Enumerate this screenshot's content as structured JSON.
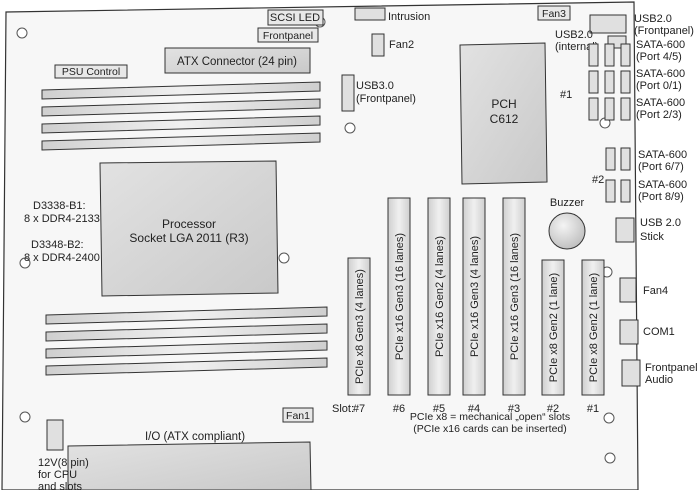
{
  "labels": {
    "scsi_led": "SCSI LED",
    "intrusion": "Intrusion",
    "fan3": "Fan3",
    "usb2_front_l1": "USB2.0",
    "usb2_front_l2": "(Frontpanel)",
    "frontpanel": "Frontpanel",
    "fan2": "Fan2",
    "usb2_internal_l1": "USB2.0",
    "usb2_internal_l2": "(internal)",
    "atx_connector": "ATX Connector (24 pin)",
    "psu_control": "PSU Control",
    "usb3_l1": "USB3.0",
    "usb3_l2": "(Frontpanel)",
    "pch_l1": "PCH",
    "pch_l2": "C612",
    "group1": "#1",
    "group2": "#2",
    "sata45_l1": "SATA-600",
    "sata45_l2": "(Port 4/5)",
    "sata01_l1": "SATA-600",
    "sata01_l2": "(Port 0/1)",
    "sata23_l1": "SATA-600",
    "sata23_l2": "(Port 2/3)",
    "sata67_l1": "SATA-600",
    "sata67_l2": "(Port 6/7)",
    "sata89_l1": "SATA-600",
    "sata89_l2": "(Port 8/9)",
    "usb2_stick_l1": "USB 2.0",
    "usb2_stick_l2": "Stick",
    "fan4": "Fan4",
    "com1": "COM1",
    "frontpanel_audio_l1": "Frontpanel",
    "frontpanel_audio_l2": "Audio",
    "buzzer": "Buzzer",
    "processor_l1": "Processor",
    "processor_l2": "Socket LGA 2011 (R3)",
    "d3338_l1": "D3338-B1:",
    "d3338_l2": "8 x DDR4-2133",
    "d3348_l1": "D3348-B2:",
    "d3348_l2": "8 x DDR4-2400",
    "fan1": "Fan1",
    "io": "I/O (ATX compliant)",
    "power12v_l1": "12V(8 pin)",
    "power12v_l2": "for CPU",
    "power12v_l3": "and slots",
    "slot_prefix": "Slot:",
    "pcie_note_l1": "PCIe x8 = mechanical „open“ slots",
    "pcie_note_l2": "(PCIe x16 cards can be inserted)"
  },
  "slots": [
    {
      "label": "PCIe x8 Gen3 (4 lanes)",
      "number": "#7"
    },
    {
      "label": "PCIe x16 Gen3 (16 lanes)",
      "number": "#6"
    },
    {
      "label": "PCIe x16 Gen2 (4 lanes)",
      "number": "#5"
    },
    {
      "label": "PCIe x16 Gen3 (4 lanes)",
      "number": "#4"
    },
    {
      "label": "PCIe x16 Gen3 (16 lanes)",
      "number": "#3"
    },
    {
      "label": "PCIe x8 Gen2 (1 lane)",
      "number": "#2"
    },
    {
      "label": "PCIe x8 Gen2 (1 lane)",
      "number": "#1"
    }
  ],
  "colors": {
    "board": "#f7f7f7",
    "component": "#d9d9d9",
    "outline": "#333333"
  }
}
